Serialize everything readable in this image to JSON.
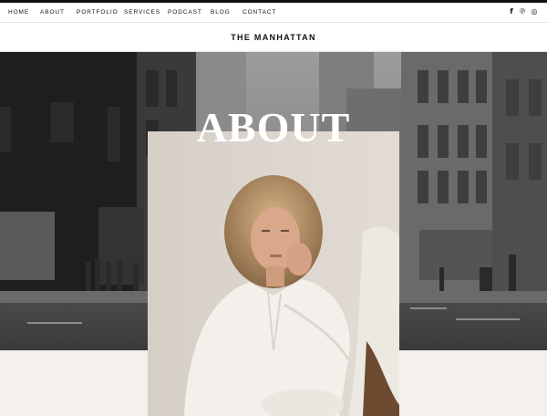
{
  "nav": {
    "items": [
      {
        "label": "HOME"
      },
      {
        "label": "ABOUT"
      },
      {
        "label": "PORTFOLIO"
      },
      {
        "label": "SERVICES"
      },
      {
        "label": "PODCAST"
      },
      {
        "label": "BLOG"
      },
      {
        "label": "CONTACT"
      }
    ],
    "social": [
      {
        "icon": "facebook-icon",
        "glyph": "f"
      },
      {
        "icon": "pinterest-icon",
        "glyph": "℗"
      },
      {
        "icon": "instagram-icon",
        "glyph": "◎"
      }
    ]
  },
  "brand": {
    "title": "THE MANHATTAN"
  },
  "hero": {
    "heading": "ABOUT"
  },
  "colors": {
    "topbar": "#111111",
    "background": "#f4f1ec",
    "heading": "#ffffff"
  }
}
